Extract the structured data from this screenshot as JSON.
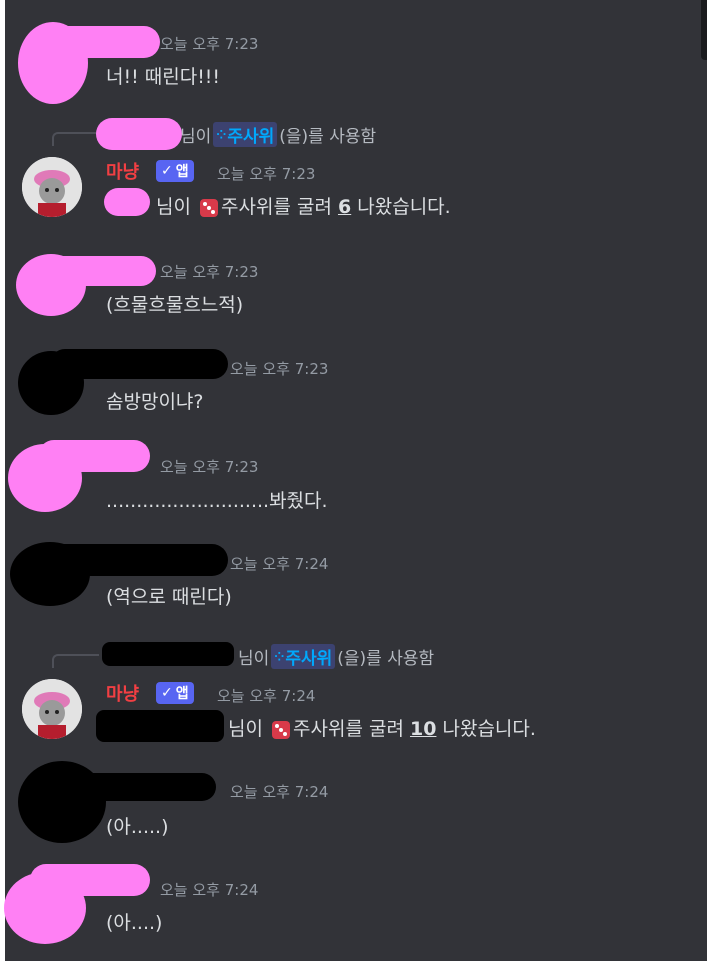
{
  "messages": [
    {
      "ts": "오늘 오후 7:23",
      "text": "너!! 때린다!!!"
    },
    {
      "cmd_suffix": "님이",
      "cmd_name": "주사위",
      "cmd_tail": "(을)를 사용함",
      "bot": "마냥",
      "app": "앱",
      "ts": "오늘 오후 7:23",
      "pre": "님이",
      "mid": "주사위를 굴려",
      "num": "6",
      "post": "나왔습니다."
    },
    {
      "ts": "오늘 오후 7:23",
      "text": "(흐물흐물흐느적)"
    },
    {
      "ts": "오늘 오후 7:23",
      "text": "솜방망이냐?"
    },
    {
      "ts": "오늘 오후 7:23",
      "text": "...........................봐줬다."
    },
    {
      "ts": "오늘 오후 7:24",
      "text": "(역으로 때린다)"
    },
    {
      "cmd_suffix": "님이",
      "cmd_name": "주사위",
      "cmd_tail": "(을)를 사용함",
      "bot": "마냥",
      "app": "앱",
      "ts": "오늘 오후 7:24",
      "pre": "님이",
      "mid": "주사위를 굴려",
      "num": "10",
      "post": "나왔습니다."
    },
    {
      "ts": "오늘 오후 7:24",
      "text": "(아.....)"
    },
    {
      "ts": "오늘 오후 7:24",
      "text": "(아....)"
    }
  ],
  "colors": {
    "background": "#323338",
    "pink_mask": "#ff80f4",
    "bot_name": "#f23f43",
    "app_badge": "#5865f2",
    "command": "#00a8fc"
  }
}
